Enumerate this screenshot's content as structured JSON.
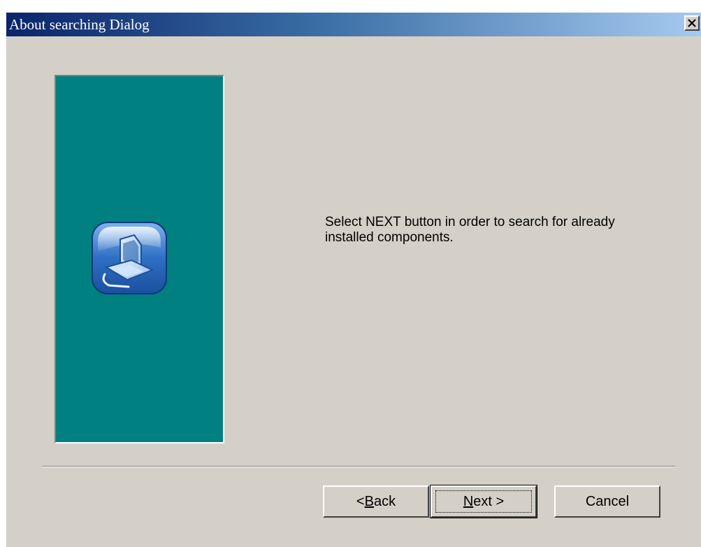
{
  "window": {
    "title": "About searching Dialog",
    "close_glyph": "×"
  },
  "icons": {
    "close": "close-icon",
    "app": "computer-setup-icon"
  },
  "content": {
    "message": "Select NEXT button in order to search for already installed components."
  },
  "buttons": {
    "back": {
      "prefix": "< ",
      "mnemonic": "B",
      "rest": "ack"
    },
    "next": {
      "mnemonic": "N",
      "rest": "ext >"
    },
    "cancel": {
      "label": "Cancel"
    }
  },
  "colors": {
    "titlebar_start": "#0a246a",
    "titlebar_end": "#a6caf0",
    "panel": "#008080",
    "face": "#d4d0c8"
  }
}
